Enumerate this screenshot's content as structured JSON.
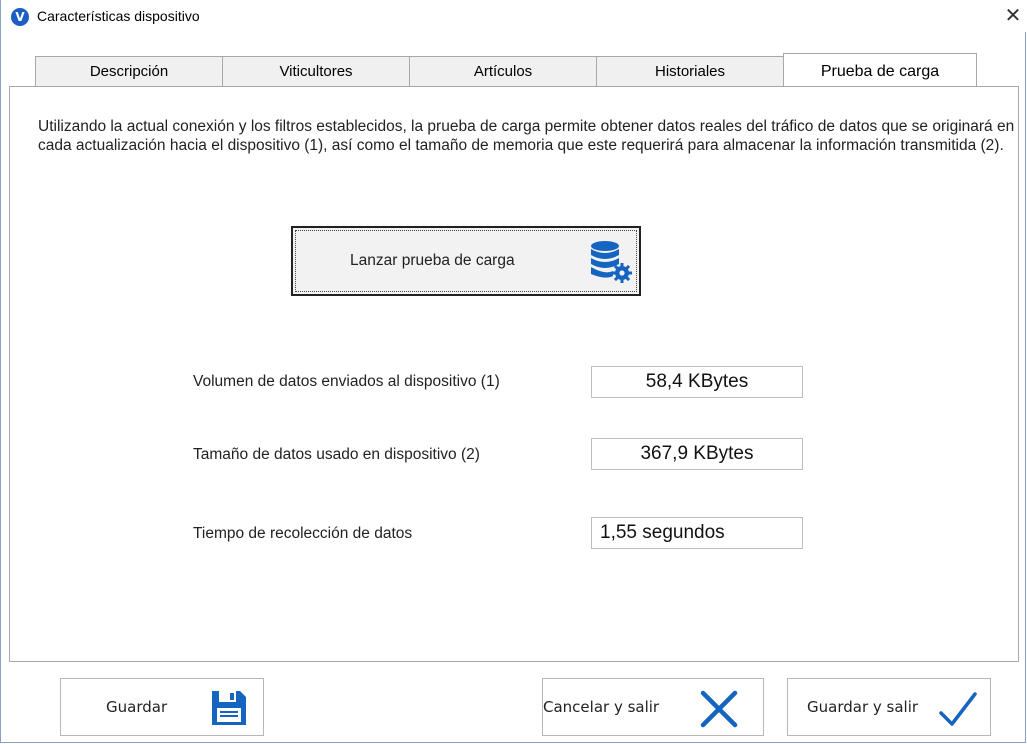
{
  "window": {
    "title": "Características dispositivo",
    "app_icon_letter": "V",
    "close_glyph": "✕"
  },
  "tabs": [
    {
      "label": "Descripción",
      "active": false
    },
    {
      "label": "Viticultores",
      "active": false
    },
    {
      "label": "Artículos",
      "active": false
    },
    {
      "label": "Historiales",
      "active": false
    },
    {
      "label": "Prueba de carga",
      "active": true
    }
  ],
  "intro_text": "Utilizando la actual conexión y los filtros establecidos, la prueba de carga permite obtener datos reales del tráfico de datos que se originará en cada actualización hacia el dispositivo (1), así como el tamaño de memoria que este requerirá para almacenar la información transmitida (2).",
  "run_button": {
    "label": "Lanzar prueba de carga",
    "icon": "database-gear-icon"
  },
  "results": [
    {
      "label": "Volumen de datos enviados al dispositivo (1)",
      "value": "58,4 KBytes"
    },
    {
      "label": "Tamaño de datos usado  en dispositivo (2)",
      "value": "367,9 KBytes"
    },
    {
      "label": "Tiempo de recolección de datos",
      "value": "1,55 segundos"
    }
  ],
  "footer": {
    "save_label": "Guardar",
    "save_icon": "floppy-disk-icon",
    "cancel_label": "Cancelar y salir",
    "cancel_icon": "x-icon",
    "save_exit_label": "Guardar y salir",
    "save_exit_icon": "checkmark-icon"
  },
  "colors": {
    "accent": "#1c5fc2",
    "icon_blue": "#1565c0"
  }
}
